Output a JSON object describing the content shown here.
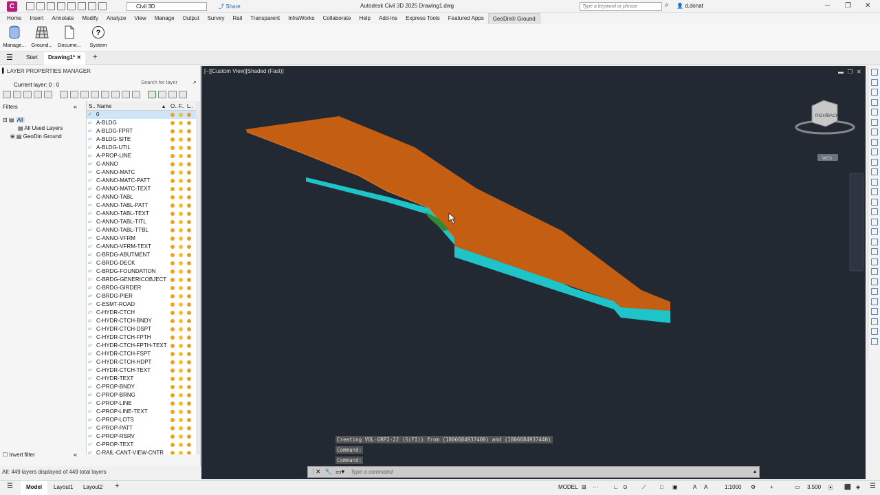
{
  "titlebar": {
    "app_logo": "C",
    "workspace": "Civil 3D",
    "share": "Share",
    "title": "Autodesk Civil 3D 2025   Drawing1.dwg",
    "search_placeholder": "Type a keyword or phrase",
    "user": "d.donat"
  },
  "menu": [
    "Home",
    "Insert",
    "Annotate",
    "Modify",
    "Analyze",
    "View",
    "Manage",
    "Output",
    "Survey",
    "Rail",
    "Transparent",
    "InfraWorks",
    "Collaborate",
    "Help",
    "Add-ins",
    "Express Tools",
    "Featured Apps",
    "GeoDin® Ground"
  ],
  "ribbon": {
    "buttons": [
      "Manage...",
      "Ground...",
      "Docume...",
      "System"
    ]
  },
  "doc_tabs": {
    "start": "Start",
    "drawing": "Drawing1*"
  },
  "layer_manager": {
    "title": "LAYER PROPERTIES MANAGER",
    "current_layer": "Current layer: 0 : 0",
    "search_placeholder": "Search for layer",
    "filters_label": "Filters",
    "tree": [
      "All",
      "All Used Layers",
      "GeoDin Ground"
    ],
    "columns": {
      "status": "S..",
      "name": "Name",
      "on": "O..",
      "freeze": "F..",
      "lock": "L.."
    },
    "layers": [
      "0",
      "A-BLDG",
      "A-BLDG-FPRT",
      "A-BLDG-SITE",
      "A-BLDG-UTIL",
      "A-PROP-LINE",
      "C-ANNO",
      "C-ANNO-MATC",
      "C-ANNO-MATC-PATT",
      "C-ANNO-MATC-TEXT",
      "C-ANNO-TABL",
      "C-ANNO-TABL-PATT",
      "C-ANNO-TABL-TEXT",
      "C-ANNO-TABL-TITL",
      "C-ANNO-TABL-TTBL",
      "C-ANNO-VFRM",
      "C-ANNO-VFRM-TEXT",
      "C-BRDG-ABUTMENT",
      "C-BRDG-DECK",
      "C-BRDG-FOUNDATION",
      "C-BRDG-GENERICOBJECT",
      "C-BRDG-GIRDER",
      "C-BRDG-PIER",
      "C-ESMT-ROAD",
      "C-HYDR-CTCH",
      "C-HYDR-CTCH-BNDY",
      "C-HYDR-CTCH-DSPT",
      "C-HYDR-CTCH-FPTH",
      "C-HYDR-CTCH-FPTH-TEXT",
      "C-HYDR-CTCH-FSPT",
      "C-HYDR-CTCH-HDPT",
      "C-HYDR-CTCH-TEXT",
      "C-HYDR-TEXT",
      "C-PROP-BNDY",
      "C-PROP-BRNG",
      "C-PROP-LINE",
      "C-PROP-LINE-TEXT",
      "C-PROP-LOTS",
      "C-PROP-PATT",
      "C-PROP-RSRV",
      "C-PROP-TEXT",
      "C-RAIL-CANT-VIEW-CNTR"
    ],
    "invert_filter": "Invert filter",
    "status": "All: 449 layers displayed of 449 total layers"
  },
  "viewport": {
    "label": "[−][Custom View][Shaded (Fast)]",
    "cube_right": "RIGHT",
    "cube_back": "BACK",
    "wcs": "WCS",
    "colors": {
      "top": "#c45e12",
      "side": "#a84c0c",
      "bottom": "#1fc4c8",
      "bg": "#222933"
    }
  },
  "command": {
    "history": [
      "Creating VOL-GRP2-22 (S(FI)) from (1806684937400) and (1806684937440)",
      "Command:",
      "Command:"
    ],
    "placeholder": "Type a command"
  },
  "statusbar": {
    "tabs": [
      "Model",
      "Layout1",
      "Layout2"
    ],
    "model": "MODEL",
    "scale": "1:1000",
    "value": "3.500"
  }
}
